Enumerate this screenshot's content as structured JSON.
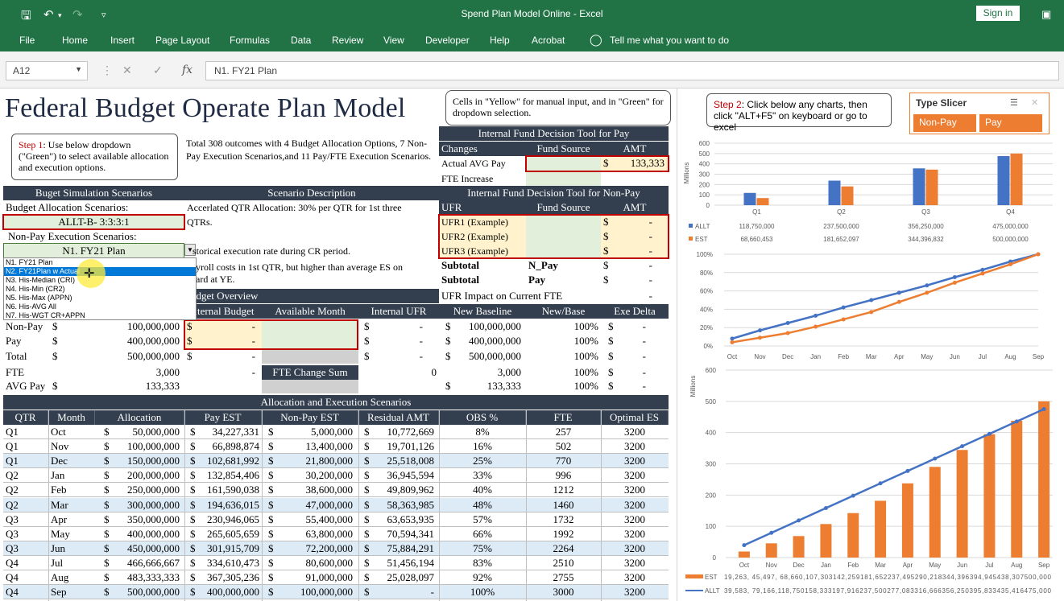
{
  "window": {
    "title": "Spend Plan Model Online  -  Excel",
    "signin": "Sign in"
  },
  "ribbon": {
    "tabs": [
      "File",
      "Home",
      "Insert",
      "Page Layout",
      "Formulas",
      "Data",
      "Review",
      "View",
      "Developer",
      "Help",
      "Acrobat"
    ],
    "tellme": "Tell me what you want to do"
  },
  "formula": {
    "namebox": "A12",
    "content": "N1. FY21 Plan"
  },
  "sheet": {
    "title": "Federal Budget Operate Plan Model",
    "callout_top": "Cells in \"Yellow\" for manual input, and in \"Green\" for dropdown selection.",
    "step1_label": "Step 1",
    "step1_text": ": Use below dropdown (\"Green\")  to select available allocation and execution options.",
    "outcomes": "Total 308 outcomes with 4 Budget Allocation Options, 7 Non-Pay Execution Scenarios,and 11 Pay/FTE Execution Scenarios.",
    "pay_tool": {
      "title": "Internal Fund Decision Tool for Pay",
      "cols": [
        "Changes",
        "Fund Source",
        "AMT"
      ],
      "rows": [
        [
          "Actual AVG Pay",
          "",
          "$",
          "133,333"
        ],
        [
          "FTE Increase",
          "",
          "",
          ""
        ]
      ]
    },
    "nonpay_tool": {
      "title": "Internal Fund Decision Tool for Non-Pay",
      "cols": [
        "UFR",
        "Fund Source",
        "AMT"
      ],
      "rows": [
        [
          "UFR1 (Example)",
          "$",
          "-"
        ],
        [
          "UFR2 (Example)",
          "$",
          "-"
        ],
        [
          "UFR3 (Example)",
          "$",
          "-"
        ]
      ],
      "subtotals": [
        [
          "Subtotal",
          "N_Pay",
          "$",
          "-"
        ],
        [
          "Subtotal",
          "Pay",
          "$",
          "-"
        ]
      ],
      "fte_impact": "UFR Impact on Current FTE",
      "fte_impact_val": "-"
    },
    "scenarios": {
      "title": "Buget Simulation Scenarios",
      "alloc_label": "Budget Allocation Scenarios:",
      "alloc_value": "ALLT-B- 3:3:3:1",
      "exec_label": "Non-Pay Execution Scenarios:",
      "exec_value": "N1. FY21 Plan"
    },
    "desc": {
      "title": "Scenario Description",
      "l1": "Accerlated QTR Allocation: 30% per QTR for 1st three",
      "l2": "QTRs.",
      "l3": "storical execution rate during CR period.",
      "l4": "yroll costs in 1st QTR, but higher than average ES on",
      "l5": "ard at YE."
    },
    "dropdown": [
      "N1. FY21 Plan",
      "N2. FY21Plan w Actual",
      "N3. His-Median (CRI)",
      "N4. His-Min (CR2)",
      "N5. His-Max (APPN)",
      "N6. His-AVG All",
      "N7. His-WGT CR+APPN"
    ],
    "overview": {
      "title": "udget Overview",
      "cols": [
        "xternal Budget",
        "Available Month",
        "Internal UFR",
        "New Baseline",
        "New/Base",
        "Exe Delta"
      ],
      "rows": [
        {
          "label": "Non-Pay",
          "d": "$",
          "v": "100,000,000",
          "ext": "$",
          "extv": "-",
          "ufr": "$",
          "ufrv": "-",
          "nbd": "$",
          "nb": "100,000,000",
          "pct": "100%",
          "ed": "$",
          "ev": "-"
        },
        {
          "label": "Pay",
          "d": "$",
          "v": "400,000,000",
          "ext": "$",
          "extv": "-",
          "ufr": "$",
          "ufrv": "-",
          "nbd": "$",
          "nb": "400,000,000",
          "pct": "100%",
          "ed": "$",
          "ev": "-"
        },
        {
          "label": "Total",
          "d": "$",
          "v": "500,000,000",
          "ext": "$",
          "extv": "-",
          "ufr": "$",
          "ufrv": "-",
          "nbd": "$",
          "nb": "500,000,000",
          "pct": "100%",
          "ed": "$",
          "ev": "-"
        },
        {
          "label": "FTE",
          "d": "",
          "v": "3,000",
          "ext": "",
          "extv": "-",
          "ufr": "",
          "ufrv": "0",
          "nbd": "",
          "nb": "3,000",
          "pct": "100%",
          "ed": "$",
          "ev": "-"
        },
        {
          "label": "AVG Pay",
          "d": "$",
          "v": "133,333",
          "ext": "",
          "extv": "",
          "ufr": "",
          "ufrv": "",
          "nbd": "$",
          "nb": "133,333",
          "pct": "100%",
          "ed": "$",
          "ev": "-"
        }
      ],
      "fte_change": "FTE Change Sum"
    },
    "alloc": {
      "title": "Allocation and Execution Scenarios",
      "cols": [
        "QTR",
        "Month",
        "Allocation",
        "Pay EST",
        "Non-Pay EST",
        "Residual AMT",
        "OBS %",
        "FTE",
        "Optimal ES"
      ],
      "rows": [
        [
          "Q1",
          "Oct",
          "50,000,000",
          "34,227,331",
          "5,000,000",
          "10,772,669",
          "8%",
          "257",
          "3200"
        ],
        [
          "Q1",
          "Nov",
          "100,000,000",
          "66,898,874",
          "13,400,000",
          "19,701,126",
          "16%",
          "502",
          "3200"
        ],
        [
          "Q1",
          "Dec",
          "150,000,000",
          "102,681,992",
          "21,800,000",
          "25,518,008",
          "25%",
          "770",
          "3200"
        ],
        [
          "Q2",
          "Jan",
          "200,000,000",
          "132,854,406",
          "30,200,000",
          "36,945,594",
          "33%",
          "996",
          "3200"
        ],
        [
          "Q2",
          "Feb",
          "250,000,000",
          "161,590,038",
          "38,600,000",
          "49,809,962",
          "40%",
          "1212",
          "3200"
        ],
        [
          "Q2",
          "Mar",
          "300,000,000",
          "194,636,015",
          "47,000,000",
          "58,363,985",
          "48%",
          "1460",
          "3200"
        ],
        [
          "Q3",
          "Apr",
          "350,000,000",
          "230,946,065",
          "55,400,000",
          "63,653,935",
          "57%",
          "1732",
          "3200"
        ],
        [
          "Q3",
          "May",
          "400,000,000",
          "265,605,659",
          "63,800,000",
          "70,594,341",
          "66%",
          "1992",
          "3200"
        ],
        [
          "Q3",
          "Jun",
          "450,000,000",
          "301,915,709",
          "72,200,000",
          "75,884,291",
          "75%",
          "2264",
          "3200"
        ],
        [
          "Q4",
          "Jul",
          "466,666,667",
          "334,610,473",
          "80,600,000",
          "51,456,194",
          "83%",
          "2510",
          "3200"
        ],
        [
          "Q4",
          "Aug",
          "483,333,333",
          "367,305,236",
          "91,000,000",
          "25,028,097",
          "92%",
          "2755",
          "3200"
        ],
        [
          "Q4",
          "Sep",
          "500,000,000",
          "400,000,000",
          "100,000,000",
          "-",
          "100%",
          "3000",
          "3200"
        ]
      ]
    }
  },
  "right": {
    "step2_label": "Step 2",
    "step2_text": ": Click below any charts, then click \"ALT+F5\" on keyboard or go to  excel",
    "slicer": {
      "title": "Type Slicer",
      "buttons": [
        "Non-Pay",
        "Pay"
      ]
    }
  },
  "chart_data": [
    {
      "type": "bar",
      "categories": [
        "Q1",
        "Q2",
        "Q3",
        "Q4"
      ],
      "ylabel": "Millions",
      "ylim": [
        0,
        600
      ],
      "yticks": [
        "0",
        "100",
        "200",
        "300",
        "400",
        "500",
        "600"
      ],
      "series": [
        {
          "name": "ALLT",
          "values": [
            118.75,
            237.5,
            356.25,
            475.0
          ],
          "labels": [
            "118,750,000",
            "237,500,000",
            "356,250,000",
            "475,000,000"
          ],
          "color": "#4472c4"
        },
        {
          "name": "EST",
          "values": [
            68.66,
            181.65,
            344.4,
            500.0
          ],
          "labels": [
            "68,660,453",
            "181,652,097",
            "344,396,832",
            "500,000,000"
          ],
          "color": "#ed7d31"
        }
      ]
    },
    {
      "type": "line",
      "categories": [
        "Oct",
        "Nov",
        "Dec",
        "Jan",
        "Feb",
        "Mar",
        "Apr",
        "May",
        "Jun",
        "Jul",
        "Aug",
        "Sep"
      ],
      "ylim": [
        0,
        100
      ],
      "yticks": [
        "0%",
        "20%",
        "40%",
        "60%",
        "80%",
        "100%"
      ],
      "series": [
        {
          "values": [
            8,
            17,
            25,
            33,
            42,
            50,
            58,
            66,
            75,
            83,
            92,
            100
          ],
          "color": "#4472c4"
        },
        {
          "values": [
            4,
            9,
            14,
            21,
            29,
            37,
            48,
            58,
            69,
            79,
            89,
            100
          ],
          "color": "#ed7d31"
        }
      ]
    },
    {
      "type": "bar",
      "categories": [
        "Oct",
        "Nov",
        "Dec",
        "Jan",
        "Feb",
        "Mar",
        "Apr",
        "May",
        "Jun",
        "Jul",
        "Aug",
        "Sep"
      ],
      "ylabel": "Millions",
      "ylim": [
        0,
        600
      ],
      "yticks": [
        "0",
        "100",
        "200",
        "300",
        "400",
        "500",
        "600"
      ],
      "series": [
        {
          "name": "EST",
          "type": "bar",
          "values": [
            19.3,
            45.5,
            68.7,
            107.3,
            142.3,
            181.7,
            237.5,
            290.2,
            344.4,
            394.9,
            437.8,
            500
          ],
          "color": "#ed7d31",
          "label_text": "19,263,  45,497,  68,660,107,303142,259181,652237,495290,218344,396394,945438,307500,000"
        },
        {
          "name": "ALLT",
          "type": "line",
          "values": [
            39.6,
            79.2,
            118.8,
            158.3,
            197.9,
            237.5,
            277.1,
            316.7,
            356.3,
            395.8,
            435.4,
            475
          ],
          "color": "#4472c4",
          "label_text": "39,583,  79,166,118,750158,333197,916237,500277,083316,666356,250395,833435,416475,000"
        }
      ]
    }
  ]
}
